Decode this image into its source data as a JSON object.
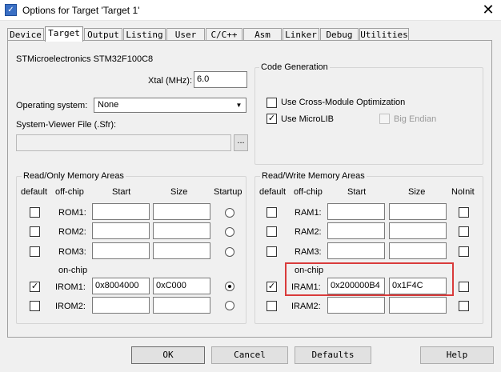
{
  "window": {
    "title": "Options for Target 'Target 1'"
  },
  "tabs": [
    "Device",
    "Target",
    "Output",
    "Listing",
    "User",
    "C/C++",
    "Asm",
    "Linker",
    "Debug",
    "Utilities"
  ],
  "device": {
    "name": "STMicroelectronics STM32F100C8",
    "xtal_label": "Xtal (MHz):",
    "xtal_value": "6.0"
  },
  "os": {
    "label": "Operating system:",
    "value": "None"
  },
  "sysviewer": {
    "label": "System-Viewer File (.Sfr):",
    "value": "",
    "browse": "..."
  },
  "codegen": {
    "title": "Code Generation",
    "cross_module": "Use Cross-Module Optimization",
    "microlib": "Use MicroLIB",
    "big_endian": "Big Endian"
  },
  "rom": {
    "title": "Read/Only Memory Areas",
    "headers": {
      "default": "default",
      "offchip": "off-chip",
      "start": "Start",
      "size": "Size",
      "startup": "Startup"
    },
    "onchip": "on-chip",
    "rows": [
      {
        "label": "ROM1:",
        "start": "",
        "size": ""
      },
      {
        "label": "ROM2:",
        "start": "",
        "size": ""
      },
      {
        "label": "ROM3:",
        "start": "",
        "size": ""
      },
      {
        "label": "IROM1:",
        "start": "0x8004000",
        "size": "0xC000"
      },
      {
        "label": "IROM2:",
        "start": "",
        "size": ""
      }
    ]
  },
  "ram": {
    "title": "Read/Write Memory Areas",
    "headers": {
      "default": "default",
      "offchip": "off-chip",
      "start": "Start",
      "size": "Size",
      "noinit": "NoInit"
    },
    "onchip": "on-chip",
    "rows": [
      {
        "label": "RAM1:",
        "start": "",
        "size": ""
      },
      {
        "label": "RAM2:",
        "start": "",
        "size": ""
      },
      {
        "label": "RAM3:",
        "start": "",
        "size": ""
      },
      {
        "label": "IRAM1:",
        "start": "0x200000B4",
        "size": "0x1F4C"
      },
      {
        "label": "IRAM2:",
        "start": "",
        "size": ""
      }
    ]
  },
  "buttons": {
    "ok": "OK",
    "cancel": "Cancel",
    "defaults": "Defaults",
    "help": "Help"
  },
  "colors": {
    "highlight": "#d93b3b",
    "icon": "#3a6fc4"
  },
  "icons": {
    "app": "keil-app-icon",
    "close": "close-icon",
    "dropdown": "chevron-down-icon",
    "checkmark": "checkmark-icon"
  }
}
